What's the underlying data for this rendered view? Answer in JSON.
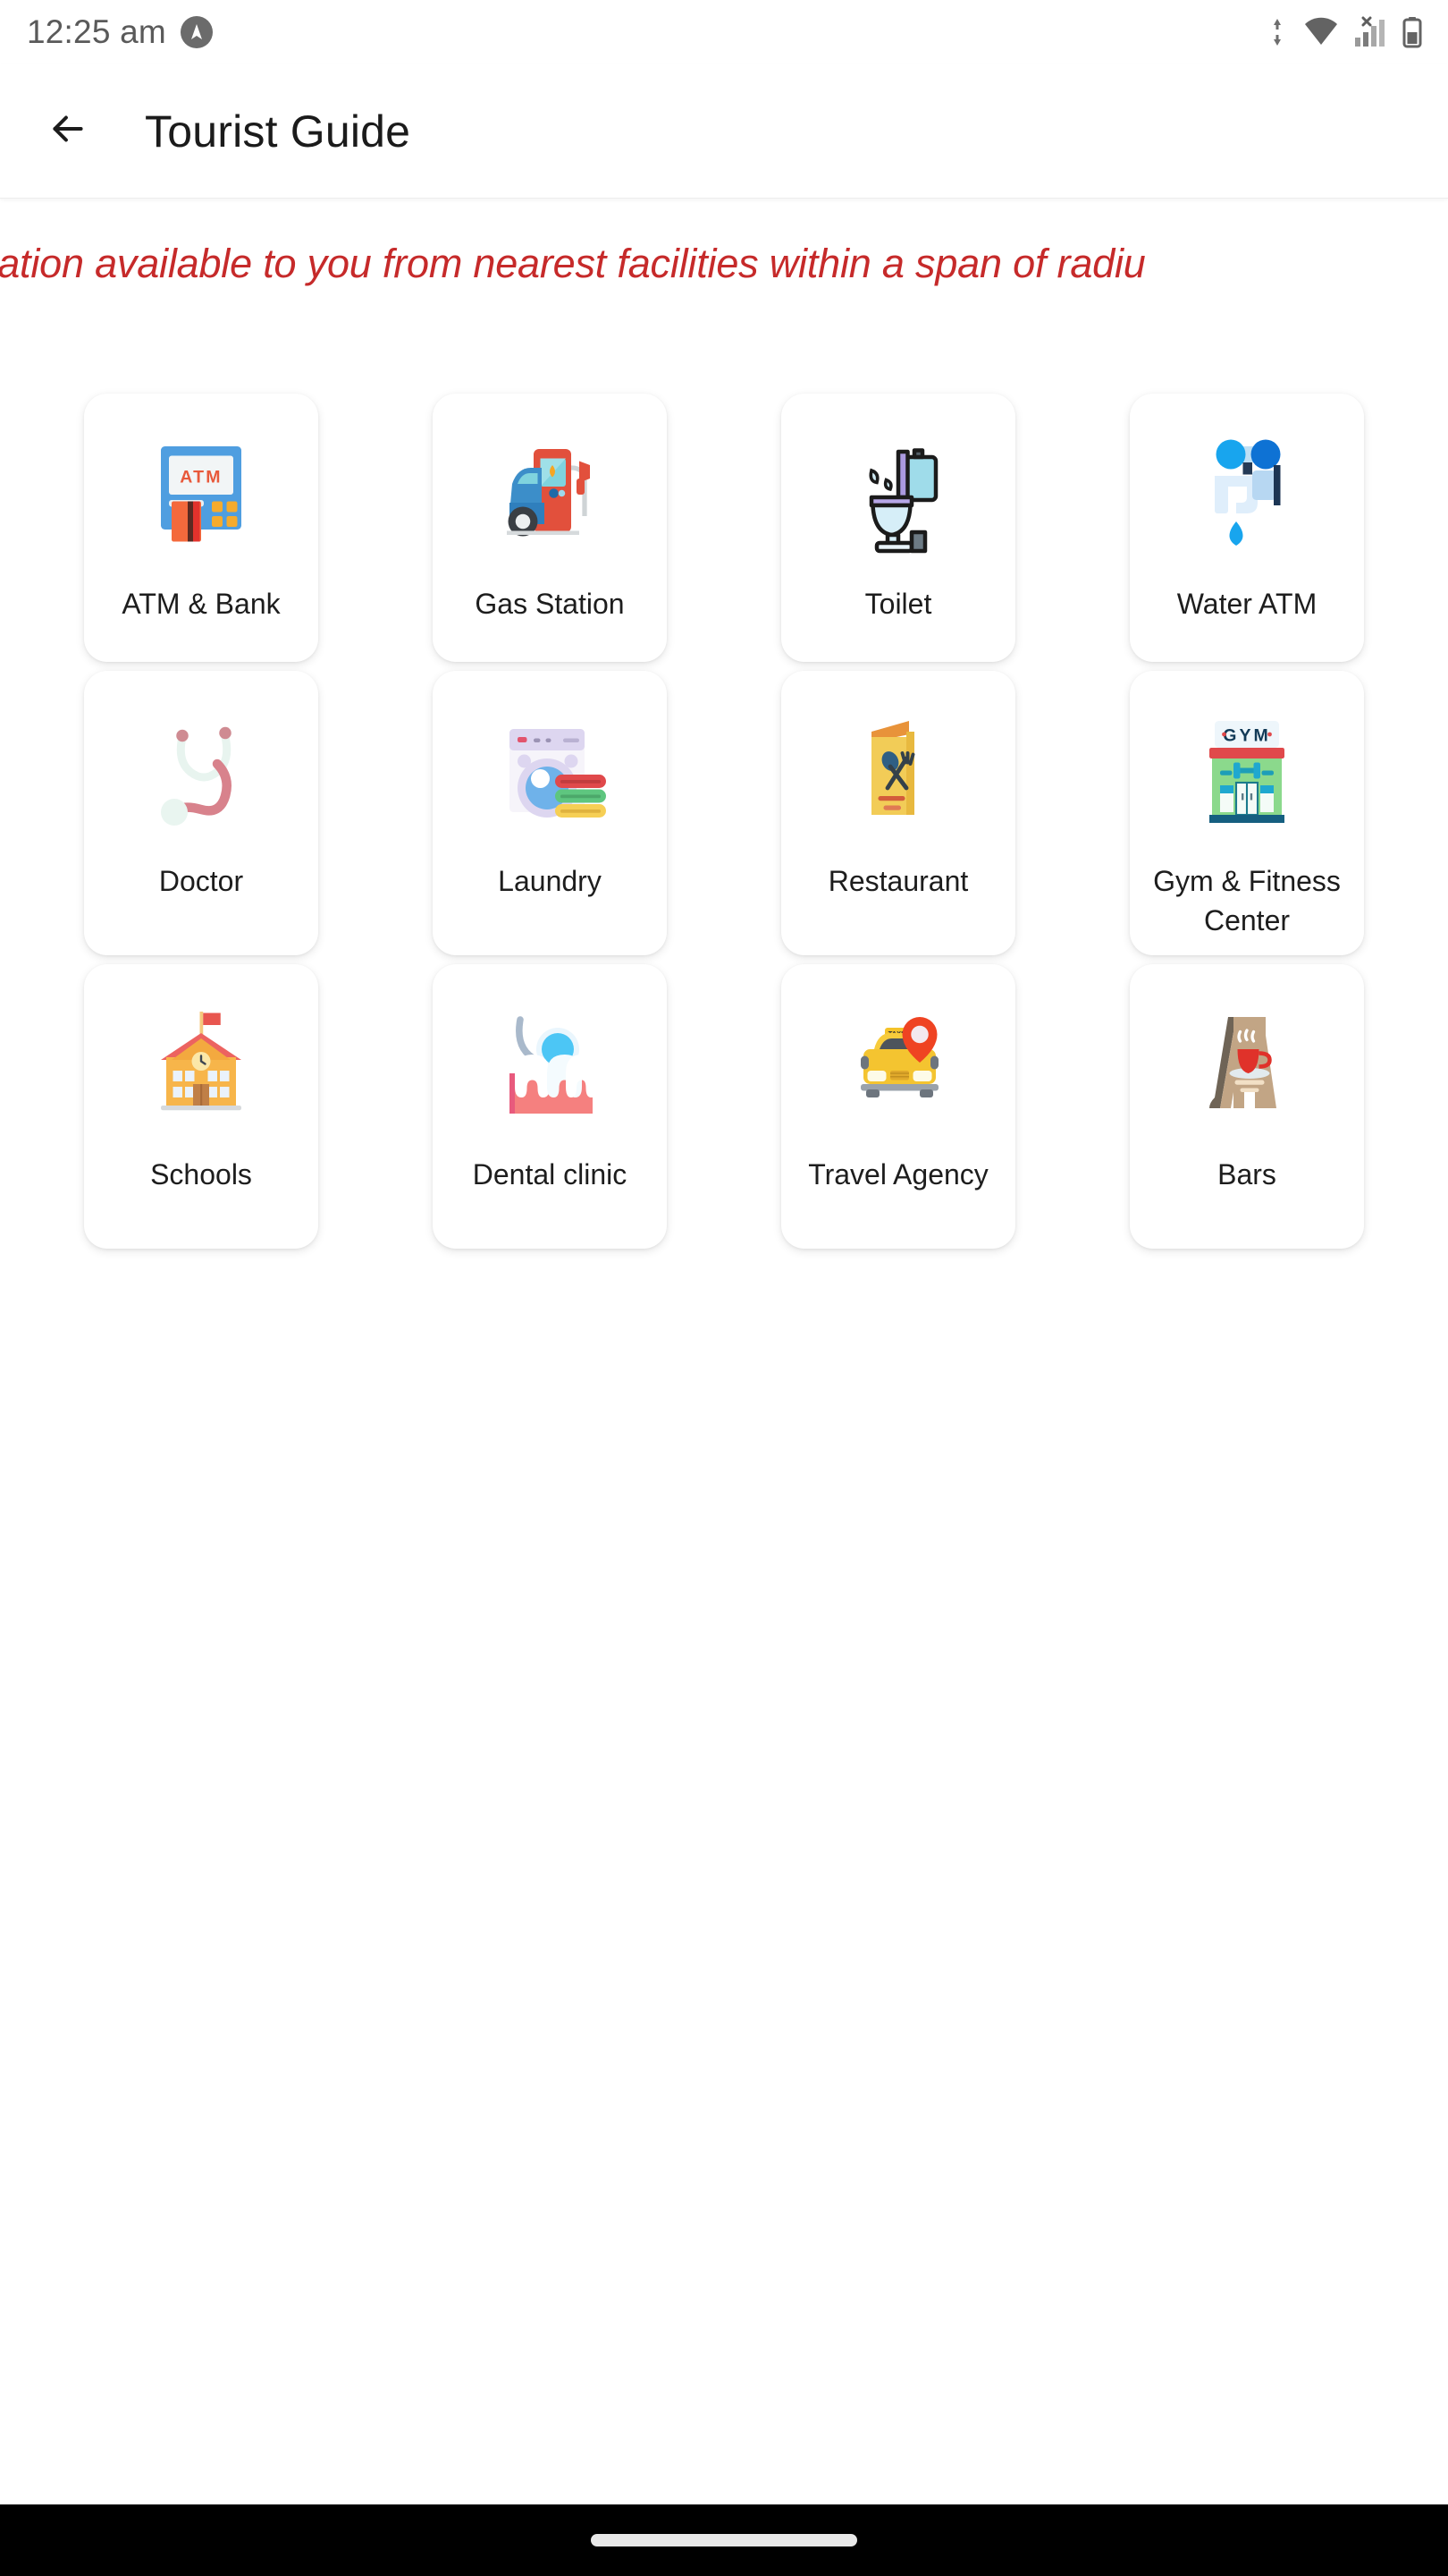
{
  "status_bar": {
    "time": "12:25 am",
    "app_badge_icon": "navigation-arrow-icon",
    "icons": [
      "data-transfer-icon",
      "wifi-icon",
      "cellular-signal-no-sim-icon",
      "battery-icon"
    ]
  },
  "app_bar": {
    "back_icon": "back-arrow-icon",
    "title": "Tourist Guide"
  },
  "marquee": {
    "text": "formation available to you from nearest facilities within a span of radiu",
    "color": "#c62a2a"
  },
  "grid": {
    "tiles": [
      {
        "label": "ATM & Bank",
        "icon": "atm-machine-icon"
      },
      {
        "label": "Gas Station",
        "icon": "gas-pump-icon"
      },
      {
        "label": "Toilet",
        "icon": "toilet-icon"
      },
      {
        "label": "Water ATM",
        "icon": "water-tap-icon"
      },
      {
        "label": "Doctor",
        "icon": "stethoscope-icon"
      },
      {
        "label": "Laundry",
        "icon": "washing-machine-icon"
      },
      {
        "label": "Restaurant",
        "icon": "menu-card-icon"
      },
      {
        "label": "Gym & Fitness Center",
        "icon": "gym-building-icon"
      },
      {
        "label": "Schools",
        "icon": "school-building-icon"
      },
      {
        "label": "Dental clinic",
        "icon": "teeth-mirror-icon"
      },
      {
        "label": "Travel Agency",
        "icon": "taxi-location-icon"
      },
      {
        "label": "Bars",
        "icon": "sandwich-board-coffee-icon"
      }
    ]
  },
  "nav_bar": {
    "gesture_pill": "home-gesture-pill"
  }
}
